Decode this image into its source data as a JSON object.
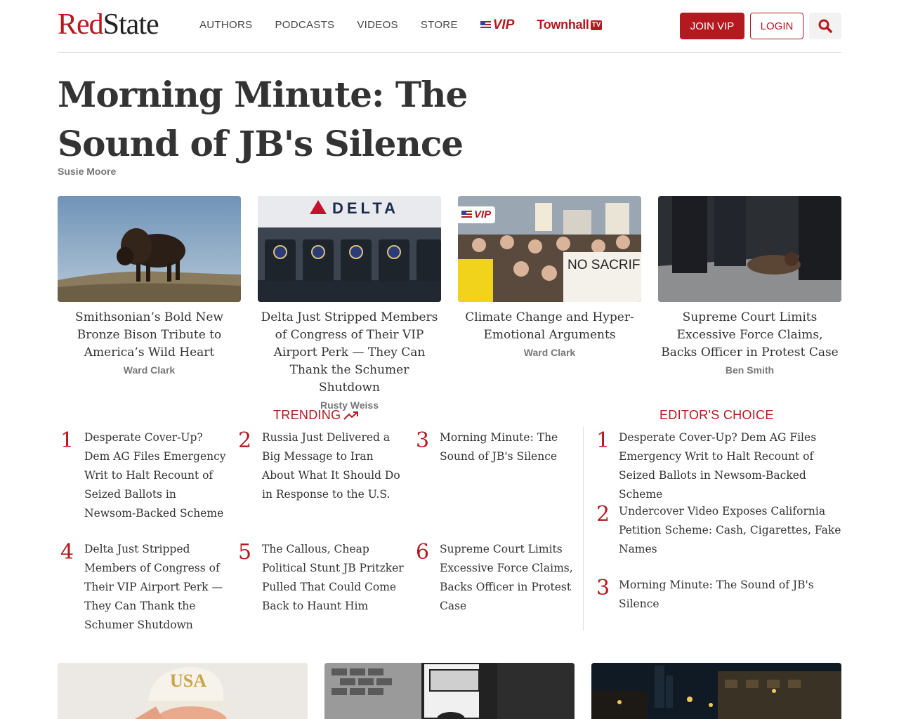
{
  "header": {
    "logo_red": "Red",
    "logo_black": "State",
    "nav": [
      "AUTHORS",
      "PODCASTS",
      "VIDEOS",
      "STORE"
    ],
    "vip_label": "VIP",
    "townhall_label": "Townhall",
    "townhall_badge": "TV",
    "join_label": "JOIN VIP",
    "login_label": "LOGIN"
  },
  "article": {
    "title": "Morning Minute: The Sound of JB's Silence",
    "author": "Susie Moore"
  },
  "cards": [
    {
      "title": "Smithsonian’s Bold New Bronze Bison Tribute to America’s Wild Heart",
      "author": "Ward Clark"
    },
    {
      "title": "Delta Just Stripped Members of Congress of Their VIP Airport Perk — They Can Thank the Schumer Shutdown",
      "author": "Rusty Weiss",
      "image_text": "DELTA"
    },
    {
      "title": "Climate Change and Hyper-Emotional Arguments",
      "author": "Ward Clark",
      "vip": "VIP",
      "sign_text": "NO SACRIFI"
    },
    {
      "title": "Supreme Court Limits Excessive Force Claims, Backs Officer in Protest Case",
      "author": "Ben Smith"
    }
  ],
  "trending": {
    "heading": "TRENDING",
    "items": [
      {
        "num": "1",
        "title": "Desperate Cover-Up? Dem AG Files Emergency Writ to Halt Recount of Seized Ballots in Newsom-Backed Scheme"
      },
      {
        "num": "2",
        "title": "Russia Just Delivered a Big Message to Iran About What It Should Do in Response to the U.S."
      },
      {
        "num": "3",
        "title": "Morning Minute: The Sound of JB's Silence"
      },
      {
        "num": "4",
        "title": "Delta Just Stripped Members of Congress of Their VIP Airport Perk — They Can Thank the Schumer Shutdown"
      },
      {
        "num": "5",
        "title": "The Callous, Cheap Political Stunt JB Pritzker Pulled That Could Come Back to Haunt Him"
      },
      {
        "num": "6",
        "title": "Supreme Court Limits Excessive Force Claims, Backs Officer in Protest Case"
      }
    ]
  },
  "editors_choice": {
    "heading": "EDITOR'S CHOICE",
    "items": [
      {
        "num": "1",
        "title": "Desperate Cover-Up? Dem AG Files Emergency Writ to Halt Recount of Seized Ballots in Newsom-Backed Scheme"
      },
      {
        "num": "2",
        "title": "Undercover Video Exposes California Petition Scheme: Cash, Cigarettes, Fake Names"
      },
      {
        "num": "3",
        "title": "Morning Minute: The Sound of JB's Silence"
      }
    ]
  },
  "bottom": {
    "cap_text": "USA"
  },
  "colors": {
    "brand_red": "#b3191f",
    "text": "#333333",
    "muted": "#777777"
  }
}
